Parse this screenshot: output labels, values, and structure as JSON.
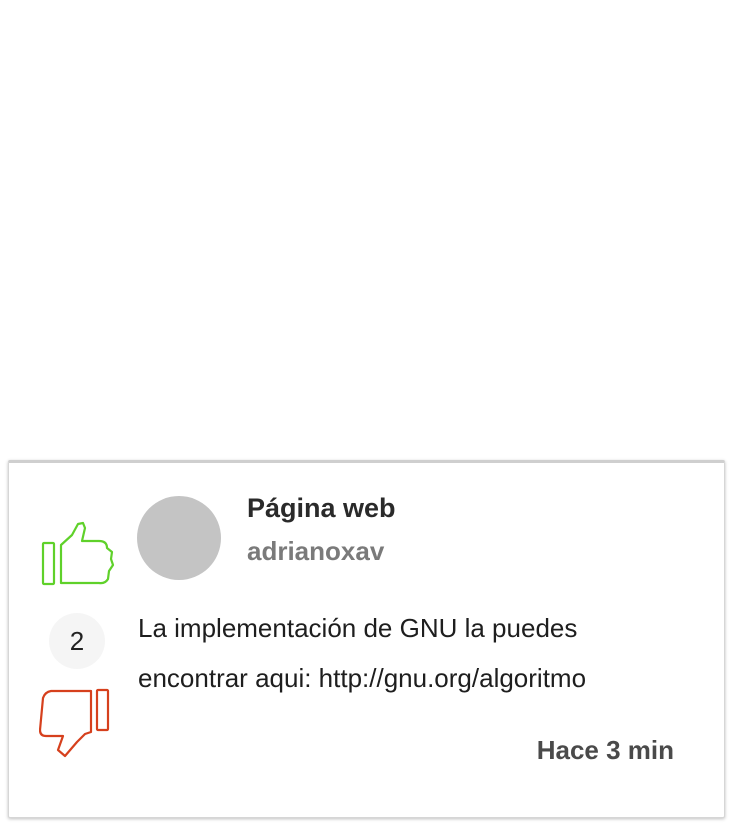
{
  "comment": {
    "title": "Página web",
    "username": "adrianoxav",
    "body_line1": "La implementación de GNU la puedes",
    "body_line2": "encontrar aqui: http://gnu.org/algoritmo",
    "timestamp": "Hace 3 min",
    "score": "2"
  },
  "icons": {
    "upvote": "thumbs-up-icon",
    "downvote": "thumbs-down-icon"
  },
  "colors": {
    "upvote": "#5fd12a",
    "downvote": "#d6401d",
    "avatar": "#c4c4c4"
  }
}
